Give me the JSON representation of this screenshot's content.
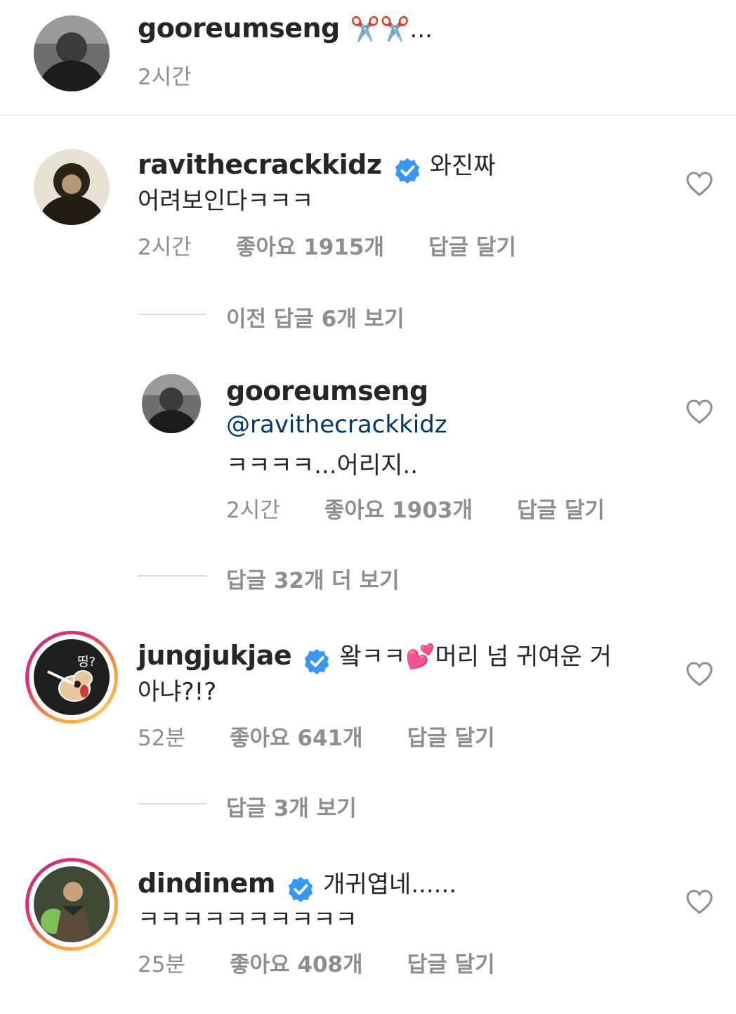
{
  "caption": {
    "username": "gooreumseng",
    "text": "✂️✂️...",
    "time": "2시간"
  },
  "comments": [
    {
      "username": "ravithecrackkidz",
      "verified": true,
      "text_line1": "와진짜",
      "text_line2": "어려보인다ㅋㅋㅋ",
      "time": "2시간",
      "likes": "좋아요 1915개",
      "reply": "답글 달기",
      "view_replies": "이전 답글 6개 보기"
    },
    {
      "username": "gooreumseng",
      "mention": "@ravithecrackkidz",
      "text": "ㅋㅋㅋㅋ...어리지..",
      "time": "2시간",
      "likes": "좋아요 1903개",
      "reply": "답글 달기",
      "view_replies": "답글 32개 더 보기"
    },
    {
      "username": "jungjukjae",
      "verified": true,
      "text_line1_a": "왘ㅋㅋ",
      "text_line1_emoji": "💕",
      "text_line1_b": "머리 넘 귀여운 거",
      "text_line2": "아냐?!?",
      "avatar_label": "띵?",
      "time": "52분",
      "likes": "좋아요 641개",
      "reply": "답글 달기",
      "view_replies": "답글 3개 보기"
    },
    {
      "username": "dindinem",
      "verified": true,
      "text_line1": "개귀엽네......",
      "text_line2": "ㅋㅋㅋㅋㅋㅋㅋㅋㅋㅋ",
      "time": "25분",
      "likes": "좋아요 408개",
      "reply": "답글 달기"
    }
  ],
  "icons": {
    "like": "heart-outline-icon",
    "verified": "verified-badge-icon"
  },
  "colors": {
    "verified": "#3897f0",
    "mention": "#00376b",
    "meta": "#8e8e8e"
  }
}
